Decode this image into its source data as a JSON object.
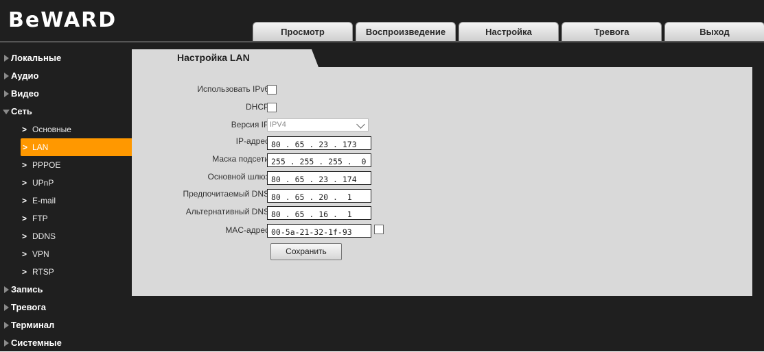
{
  "brand": {
    "logo_text": "BeWARD"
  },
  "nav": {
    "tabs": [
      "Просмотр",
      "Воспроизведение",
      "Настройка",
      "Тревога",
      "Выход"
    ]
  },
  "sidebar": {
    "sections": [
      {
        "label": "Локальные",
        "expanded": false
      },
      {
        "label": "Аудио",
        "expanded": false
      },
      {
        "label": "Видео",
        "expanded": false
      },
      {
        "label": "Сеть",
        "expanded": true
      }
    ],
    "network_items": [
      "Основные",
      "LAN",
      "PPPOE",
      "UPnP",
      "E-mail",
      "FTP",
      "DDNS",
      "VPN",
      "RTSP"
    ],
    "active_item": "LAN",
    "tail_sections": [
      "Запись",
      "Тревога",
      "Терминал",
      "Системные"
    ]
  },
  "page": {
    "tab_title": "Настройка LAN",
    "form": {
      "ipv6_label": "Использовать IPv6",
      "ipv6_checked": false,
      "dhcp_label": "DHCP",
      "dhcp_checked": false,
      "ip_version_label": "Версия IP",
      "ip_version_value": "IPV4",
      "ip_label": "IP-адрес",
      "ip_value": "80 . 65 . 23 . 173",
      "mask_label": "Маска подсети",
      "mask_value": "255 . 255 . 255 .  0",
      "gateway_label": "Основной шлюз",
      "gateway_value": "80 . 65 . 23 . 174",
      "dns1_label": "Предпочитаемый DNS",
      "dns1_value": "80 . 65 . 20 .  1",
      "dns2_label": "Альтернативный DNS",
      "dns2_value": "80 . 65 . 16 .  1",
      "mac_label": "MAC-адрес",
      "mac_value": "00-5a-21-32-1f-93",
      "mac_checked": false,
      "save_label": "Сохранить"
    }
  },
  "colors": {
    "accent": "#ff9800",
    "background": "#1f1f1f",
    "panel": "#d9d9d9"
  }
}
